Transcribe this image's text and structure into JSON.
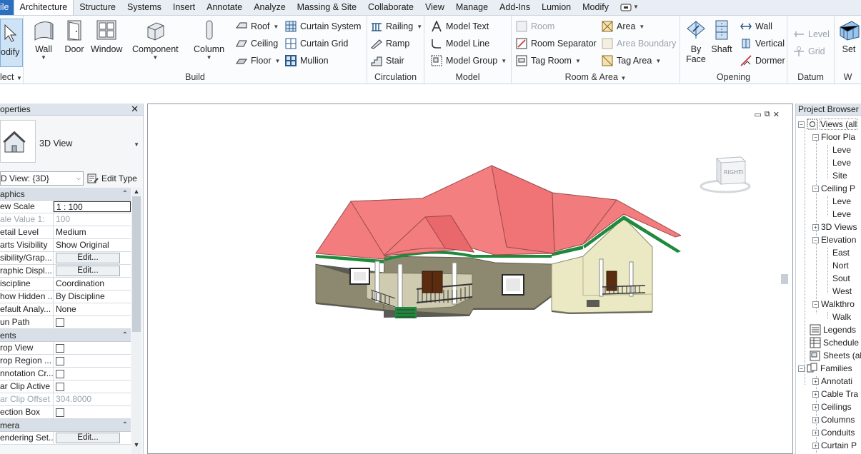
{
  "ribbon_tabs": [
    "ile",
    "Architecture",
    "Structure",
    "Systems",
    "Insert",
    "Annotate",
    "Analyze",
    "Massing & Site",
    "Collaborate",
    "View",
    "Manage",
    "Add-Ins",
    "Lumion",
    "Modify"
  ],
  "active_tab": "Architecture",
  "ribbon": {
    "select": {
      "modify": "odify",
      "panel": "lect"
    },
    "build": {
      "panel": "Build",
      "wall": "Wall",
      "door": "Door",
      "window": "Window",
      "component": "Component",
      "column": "Column",
      "roof": "Roof",
      "ceiling": "Ceiling",
      "floor": "Floor",
      "curtain_system": "Curtain System",
      "curtain_grid": "Curtain Grid",
      "mullion": "Mullion"
    },
    "circulation": {
      "panel": "Circulation",
      "railing": "Railing",
      "ramp": "Ramp",
      "stair": "Stair"
    },
    "model": {
      "panel": "Model",
      "model_text": "Model Text",
      "model_line": "Model Line",
      "model_group": "Model Group"
    },
    "room_area": {
      "panel": "Room & Area",
      "room": "Room",
      "room_separator": "Room Separator",
      "tag_room": "Tag Room",
      "area": "Area",
      "area_boundary": "Area Boundary",
      "tag_area": "Tag Area"
    },
    "opening": {
      "panel": "Opening",
      "by_face_1": "By",
      "by_face_2": "Face",
      "shaft": "Shaft",
      "wall": "Wall",
      "vertical": "Vertical",
      "dormer": "Dormer"
    },
    "datum": {
      "panel": "Datum",
      "level": "Level",
      "grid": "Grid"
    },
    "work_plane": {
      "set": "Set",
      "panel": "W"
    }
  },
  "properties": {
    "title": "operties",
    "type_name": "3D View",
    "view_selector": "D View: {3D}",
    "edit_type": "Edit Type",
    "groups": [
      {
        "name": "aphics",
        "rows": [
          {
            "name": "ew Scale",
            "value": "1 : 100",
            "kind": "input"
          },
          {
            "name": "ale Value   1:",
            "value": "100",
            "kind": "grey"
          },
          {
            "name": "etail Level",
            "value": "Medium"
          },
          {
            "name": "arts Visibility",
            "value": "Show Original"
          },
          {
            "name": "sibility/Grap...",
            "value": "Edit...",
            "kind": "button"
          },
          {
            "name": "raphic Displ...",
            "value": "Edit...",
            "kind": "button"
          },
          {
            "name": "iscipline",
            "value": "Coordination"
          },
          {
            "name": "how Hidden ...",
            "value": "By Discipline"
          },
          {
            "name": "efault Analy...",
            "value": "None"
          },
          {
            "name": "un Path",
            "value": "",
            "kind": "checkbox"
          }
        ]
      },
      {
        "name": "ents",
        "rows": [
          {
            "name": "rop View",
            "value": "",
            "kind": "checkbox"
          },
          {
            "name": "rop Region ...",
            "value": "",
            "kind": "checkbox"
          },
          {
            "name": "nnotation Cr...",
            "value": "",
            "kind": "checkbox"
          },
          {
            "name": "ar Clip Active",
            "value": "",
            "kind": "checkbox"
          },
          {
            "name": "ar Clip Offset",
            "value": "304.8000",
            "kind": "grey"
          },
          {
            "name": "ection Box",
            "value": "",
            "kind": "checkbox"
          }
        ]
      },
      {
        "name": "mera",
        "rows": [
          {
            "name": "endering Set...",
            "value": "Edit...",
            "kind": "button"
          }
        ]
      }
    ]
  },
  "viewcube": {
    "face": "RIGHT"
  },
  "project_browser": {
    "title": "Project Browser -",
    "views_root": "Views (all",
    "floor_plans": "Floor Pla",
    "level_a": "Leve",
    "level_b": "Leve",
    "site": "Site",
    "ceiling_plans": "Ceiling P",
    "ceiling_a": "Leve",
    "ceiling_b": "Leve",
    "views_3d": "3D Views",
    "elevations": "Elevation",
    "east": "East",
    "north": "Nort",
    "south": "Sout",
    "west": "West",
    "walkthrough": "Walkthro",
    "walk": "Walk",
    "legends": "Legends",
    "schedules": "Schedule",
    "sheets": "Sheets (al",
    "families": "Families",
    "annotation": "Annotati",
    "cable_trays": "Cable Tra",
    "ceilings": "Ceilings",
    "columns": "Columns",
    "conduits": "Conduits",
    "curtain_panels": "Curtain P"
  },
  "colors": {
    "file_tab": "#2c6fbe",
    "roof": "#f27c7e",
    "walls": "#8d8870",
    "walls_light": "#ebe8c4",
    "trim": "#1f8a3c"
  }
}
